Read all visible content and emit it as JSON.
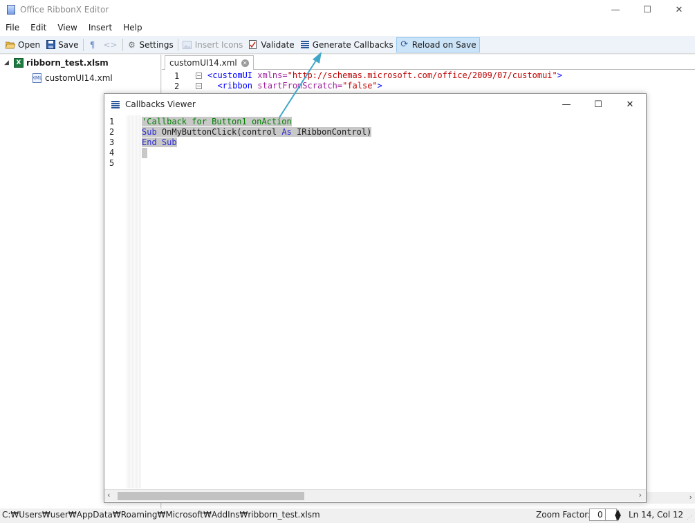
{
  "window": {
    "title": "Office RibbonX Editor",
    "controls": {
      "minimize": "—",
      "maximize": "☐",
      "close": "✕"
    }
  },
  "menu": [
    "File",
    "Edit",
    "View",
    "Insert",
    "Help"
  ],
  "toolbar": {
    "open": "Open",
    "save": "Save",
    "settings": "Settings",
    "insert_icons": "Insert Icons",
    "validate": "Validate",
    "generate_callbacks": "Generate Callbacks",
    "reload_on_save": "Reload on Save"
  },
  "tree": {
    "file": "ribborn_test.xlsm",
    "part": "customUI14.xml"
  },
  "editor": {
    "tab": "customUI14.xml",
    "lines": [
      {
        "num": "1",
        "tag_open": "<customUI ",
        "attr": "xmlns=",
        "value": "\"http://schemas.microsoft.com/office/2009/07/customui\"",
        "tag_close": ">"
      },
      {
        "num": "2",
        "tag_open": "  <ribbon ",
        "attr": "startFromScratch=",
        "value": "\"false\"",
        "tag_close": ">"
      }
    ]
  },
  "dialog": {
    "title": "Callbacks Viewer",
    "line_numbers": [
      "1",
      "2",
      "3",
      "4",
      "5"
    ],
    "code": {
      "comment": "'Callback for Button1 onAction",
      "sub_kw": "Sub",
      "sub_name": " OnMyButtonClick(control ",
      "as_kw": "As",
      "type": " IRibbonControl)",
      "end_kw": "End Sub"
    }
  },
  "status": {
    "path": "C:₩Users₩user₩AppData₩Roaming₩Microsoft₩AddIns₩ribborn_test.xlsm",
    "zoom_label": "Zoom Factor:",
    "zoom_value": "0",
    "ln": "Ln 14,",
    "col": "Col 12"
  },
  "colors": {
    "arrow": "#3fa7c8",
    "toolbar_active": "#cce4f7",
    "selection": "#c8c8c8"
  }
}
